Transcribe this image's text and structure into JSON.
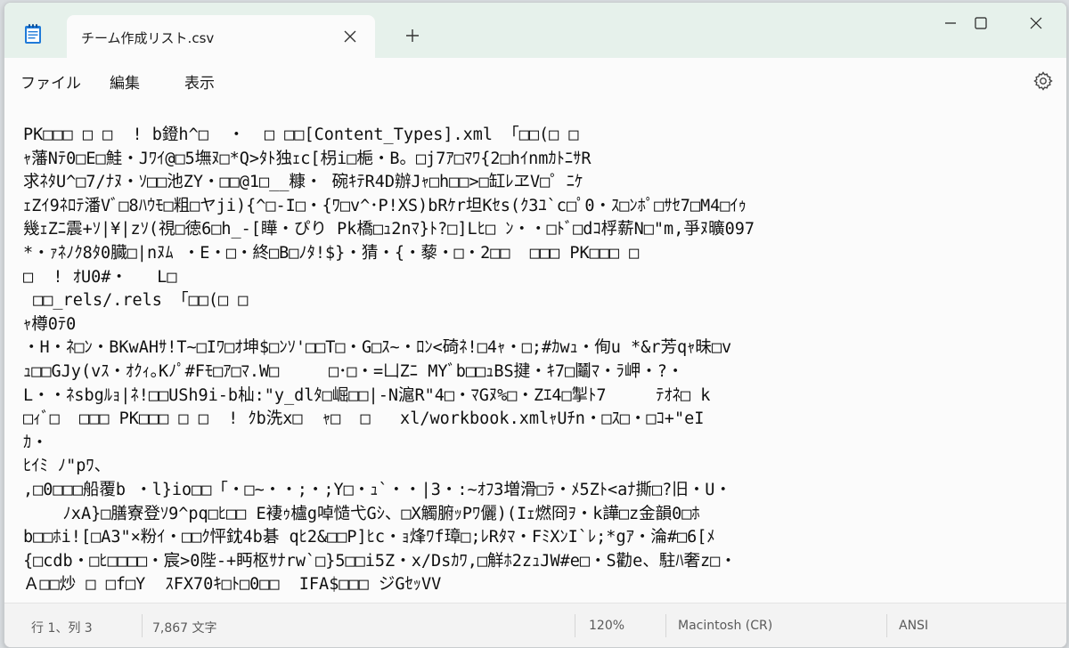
{
  "tab": {
    "title": "チーム作成リスト.csv"
  },
  "icons": {
    "app": "notepad-icon",
    "close_tab": "close-icon",
    "new_tab": "plus-icon",
    "minimize": "minimize-icon",
    "maximize": "maximize-icon",
    "close_window": "close-icon",
    "settings": "gear-icon"
  },
  "menu": {
    "file": "ファイル",
    "edit": "編集",
    "view": "表示"
  },
  "editor": {
    "lines": [
      "PK□□□ □ □  ! b鐙h^□  ・  □ □□[Content_Types].xml 「□□(□ □",
      "ｬ藩Nﾃ0□E□鮭・Jﾜｲ@□5墲ﾇ□*Q>ﾀﾄ独ｪc[枴i□梔・B。□j7ｱ□ﾏﾜ{2□hｲnmｶﾄﾆｻR",
      "求ﾈﾀU^□7/ﾅﾇ・ｿ□□池ZY・□□@1□__糠・ 碗ｷﾃR4D辦Jｬ□h□□>□缸ﾚヱV□゜ﾆｹ",
      "ｪZｲ9ﾈﾛﾃ潘Vﾞ□8ﾊｳﾓ□粗□ヤji){^□-I□・{ﾜ□v^･P!XS)bRｹr坦Kｾs(ｸ3ﾕ`c□ﾟ0・ｽ□ﾝﾎﾟ□ｻｾ7□M4□ｲｩ",
      "幾ｪZﾆ震+ｿ|¥|zｿ(視□徳6□h_-[瞱・ぴり Pk橋□ｭ2nﾏ}ﾄ?□]Lﾋ□ ﾝ・・□ﾄﾞ□dｺ桴薪N□\"m,爭ﾇ曠097",
      "*・ｧﾈﾉｸ8ﾀ0臓□|nﾇﾑ ・E・□・終□B□ﾉﾀ!$}・猜・{・藜・□・2□□  □□□ PK□□□ □",
      "□  ! ｵU0#・   L□",
      " □□_rels/.rels 「□□(□ □",
      "ｬ樽0ﾃ0",
      "・H・ﾈ□ﾝ・BKwAHｻ!T~□Iﾜ□ｵ坤$□ﾝｿ'□□T□・G□ｽ~・ﾛﾝ<碕ﾈ!□4ｬ・□;#ｶwｭ・侚u *&r芳qｬ昧□v",
      "ｭ□□GJy(vｽ・ｵｸｨ｡Kﾉﾟ#Fﾓ□ｱ□ﾏ.W□     □･□・=凵Zﾆ MYﾞb□□ｭBS揵・ｷ7□鬮ﾏ・ﾗ岬・?・",
      "L・・ﾈsbgﾙｮ|ﾈ!□□USh9i-b杣:\"y_dlﾀ□崛□□|-N滬R\"4□・ﾏGﾇ%□・Zｴ4□掣ﾄ7     ﾃｵﾈ□ k",
      "□ｨﾞ□  □□□ PK□□□ □ □  ! ｸb洗x□  ｬ□  □   xl/workbook.xmlｬUﾁn・□ｽ□・□ｺ+\"eI",
      "ｶ・",
      "ﾋｲﾐ ﾉ\"pﾜ、",
      ",□0□□□船覆b ・l}io□□「・□~・・;・;Y□・ｭ`・・|3・:~ｵﾌ3増滑□ﾗ・ﾒ5Zﾄ<aﾅ撕□?旧・U・",
      "    ﾉxA}□膳寮登ｿ9^pq□ﾋ□□ E褄ｩ櫨g啅慥弋Gｼ、□X觸腑ｯPﾜ儷)(Iｪ燃冏ｦ・k譁□z金韻0□ﾎ",
      "b□□ﾎi![□A3\"×粉ｲ・□□ｸ怦鈂4b碁 qﾋ2&□□P]ﾋc・ｮ烽ﾜf璋□;ﾚRﾀﾏ・FﾐXﾝI`ﾚ;*gｱ・淪#□6[ﾒ",
      "{□cdb・□ﾋ□□□□・宸>0陛-+眄枢ｻﾅrw`□}5□□i5Z・x/Dsｶﾜ,□觧ﾎ2zｭJW#e□・S勸e、駐ﾊ奢z□・",
      "Ａ□□炒 □ □f□Y  ｽFX70ｷ□ﾄ□0□□  IFA$□□□ ジGｾｯVV"
    ]
  },
  "status": {
    "position": "行 1、列 3",
    "chars": "7,867 文字",
    "zoom": "120%",
    "line_ending": "Macintosh (CR)",
    "encoding": "ANSI"
  }
}
